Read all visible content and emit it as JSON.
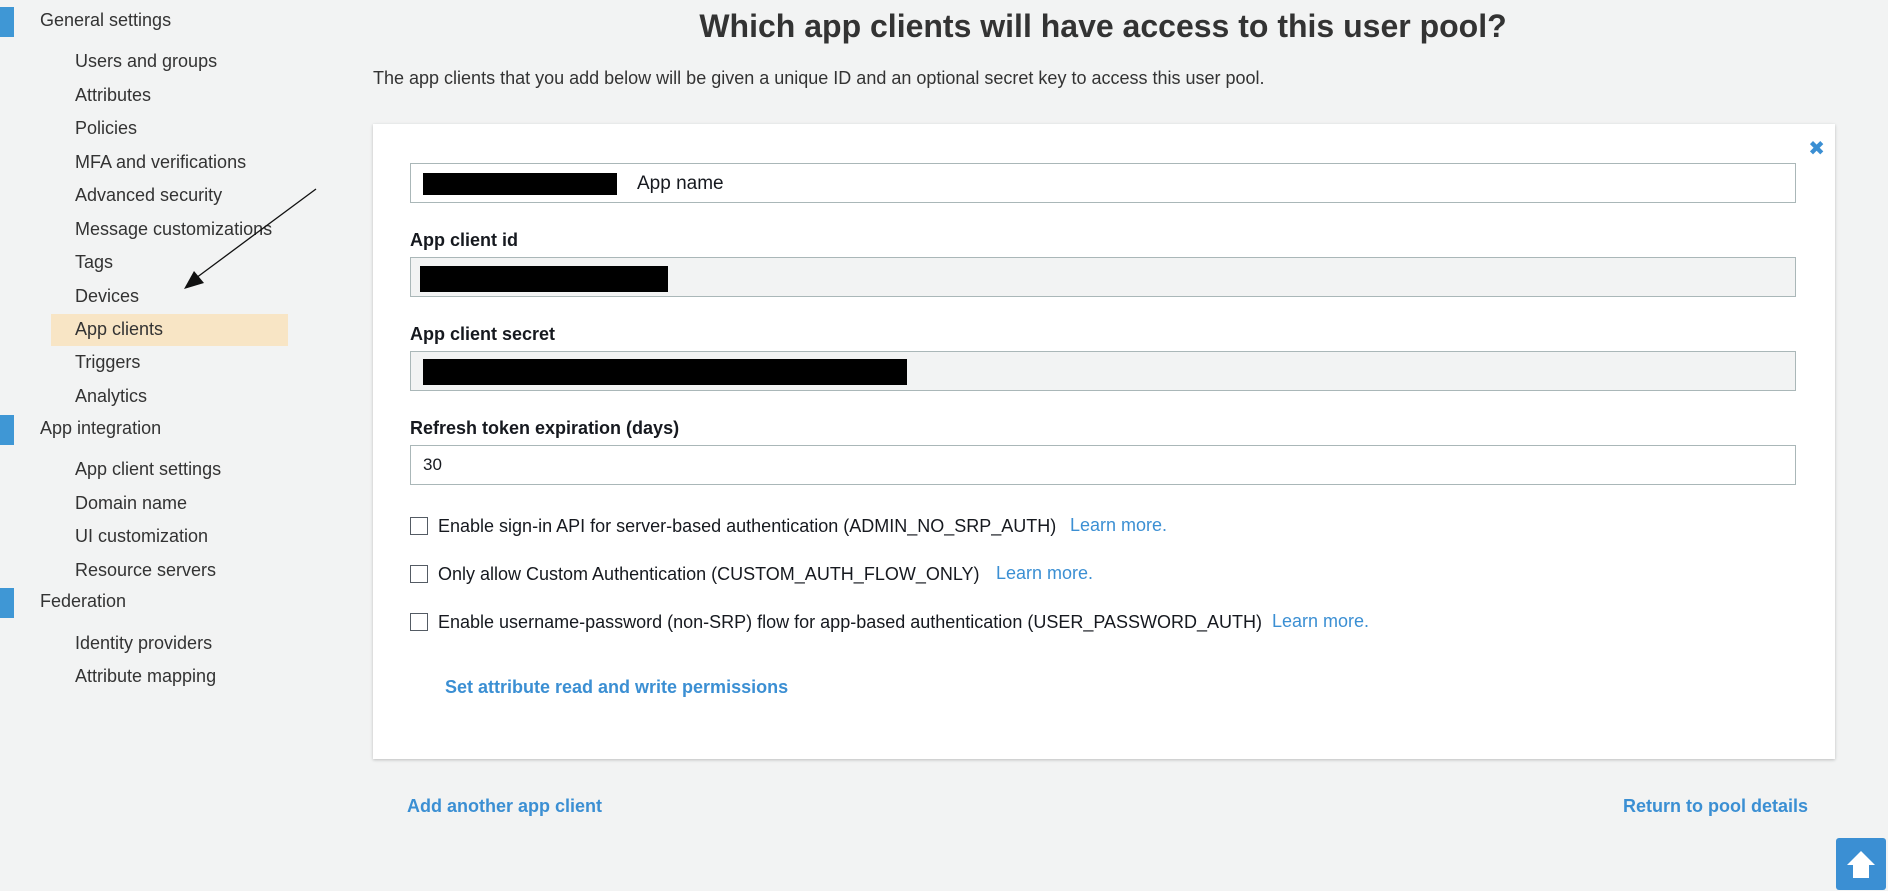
{
  "sidebar": {
    "sections": [
      {
        "label": "General settings",
        "items": [
          "Users and groups",
          "Attributes",
          "Policies",
          "MFA and verifications",
          "Advanced security",
          "Message customizations",
          "Tags",
          "Devices",
          "App clients",
          "Triggers",
          "Analytics"
        ]
      },
      {
        "label": "App integration",
        "items": [
          "App client settings",
          "Domain name",
          "UI customization",
          "Resource servers"
        ]
      },
      {
        "label": "Federation",
        "items": [
          "Identity providers",
          "Attribute mapping"
        ]
      }
    ],
    "active_item": "App clients"
  },
  "main": {
    "title": "Which app clients will have access to this user pool?",
    "description": "The app clients that you add below will be given a unique ID and an optional secret key to access this user pool.",
    "app_client": {
      "app_name_label": "App name",
      "client_id_label": "App client id",
      "client_secret_label": "App client secret",
      "refresh_label": "Refresh token expiration (days)",
      "refresh_value": "30",
      "options": [
        {
          "label": "Enable sign-in API for server-based authentication (ADMIN_NO_SRP_AUTH)",
          "checked": false,
          "link": "Learn more."
        },
        {
          "label": "Only allow Custom Authentication (CUSTOM_AUTH_FLOW_ONLY)",
          "checked": false,
          "link": "Learn more."
        },
        {
          "label": "Enable username-password (non-SRP) flow for app-based authentication (USER_PASSWORD_AUTH)",
          "checked": false,
          "link": "Learn more."
        }
      ],
      "permissions_link": "Set attribute read and write permissions"
    },
    "add_client_link": "Add another app client",
    "return_link": "Return to pool details"
  },
  "icons": {
    "close": "close-icon",
    "scroll_top": "arrow-up-icon",
    "annotation": "annotation-arrow-icon"
  },
  "colors": {
    "accent": "#3b8fd3",
    "section_bar": "#3f97d5",
    "active_item_bg": "#f8e5c5",
    "page_bg": "#f2f3f3"
  }
}
